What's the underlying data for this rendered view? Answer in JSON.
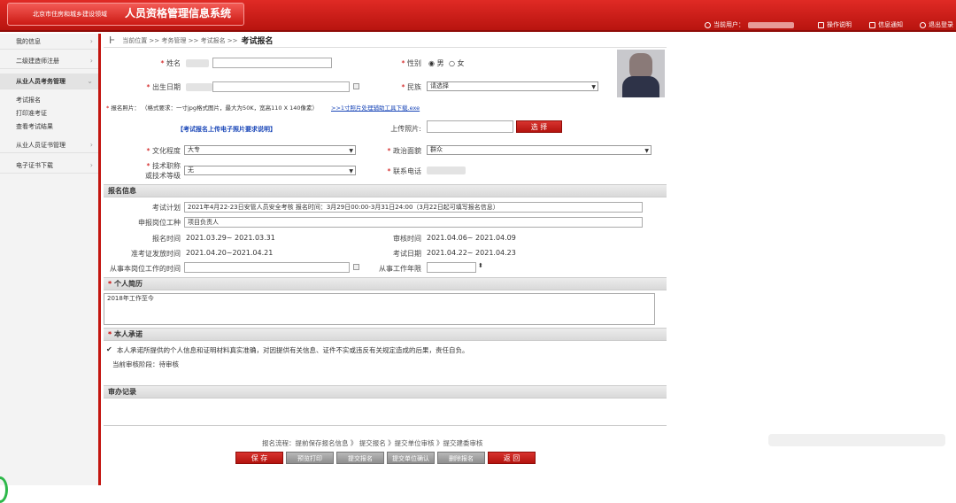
{
  "header": {
    "org": "北京市住房和城乡建设领域",
    "system": "人员资格管理信息系统",
    "current_user_label": "当前用户：",
    "links": [
      "操作说明",
      "信息通知",
      "退出登录"
    ]
  },
  "nav": {
    "items": [
      "我的信息",
      "二级建造师注册",
      "从业人员考务管理",
      "从业人员证书管理",
      "电子证书下载"
    ],
    "subitems": [
      "考试报名",
      "打印准考证",
      "查看考试结果"
    ]
  },
  "breadcrumb": {
    "prefix": "当前位置 >> 考务管理 >> 考试报名 >>",
    "current": "考试报名"
  },
  "form": {
    "name_label": "姓名",
    "gender_label": "性别",
    "gender_male": "男",
    "gender_female": "女",
    "birth_label": "出生日期",
    "nation_label": "民族",
    "nation_value": "请选择",
    "photo_label": "报名照片：",
    "photo_req": "（格式要求：一寸jpg格式图片，最大为50K，宽高110 X 140像素）",
    "photo_tool_link": ">>1寸照片处理辅助工具下载.exe",
    "photo_help_link": "【考试报名上传电子照片要求说明】",
    "upload_label": "上传照片:",
    "select_button": "选 择",
    "education_label": "文化程度",
    "education_value": "大专",
    "politics_label": "政治面貌",
    "politics_value": "群众",
    "title_label": "技术职称",
    "title_label2": "或技术等级",
    "title_value": "无",
    "contact_label": "联系电话"
  },
  "signup": {
    "section_title": "报名信息",
    "plan_label": "考试计划",
    "plan_value": "2021年4月22-23日安管人员安全考核  报名时间：3月29日00:00-3月31日24:00（3月22日起可填写报名信息）",
    "position_label": "申报岗位工种",
    "position_value": "项目负责人",
    "signup_time_label": "报名时间",
    "signup_time_value": "2021.03.29~ 2021.03.31",
    "review_time_label": "审核时间",
    "review_time_value": "2021.04.06~ 2021.04.09",
    "admit_time_label": "准考证发放时间",
    "admit_time_value": "2021.04.20~2021.04.21",
    "exam_date_label": "考试日期",
    "exam_date_value": "2021.04.22~ 2021.04.23",
    "start_work_label": "从事本岗位工作的时间",
    "years_label": "从事工作年限"
  },
  "resume": {
    "section_title": "个人简历",
    "value": "2018年工作至今"
  },
  "commit": {
    "section_title": "本人承诺",
    "text": "本人承诺所提供的个人信息和证明材料真实准确，对因提供有关信息、证件不实或违反有关规定造成的后果，责任自负。",
    "stage": "当前审核阶段：待审核"
  },
  "records": {
    "section_title": "审办记录"
  },
  "flow": {
    "text": "报名流程：提前保存报名信息 》 提交报名 》提交单位审核 》提交建委审核",
    "buttons": [
      "保 存",
      "预览打印",
      "提交报名",
      "提交单位确认",
      "删除报名",
      "返 回"
    ]
  }
}
